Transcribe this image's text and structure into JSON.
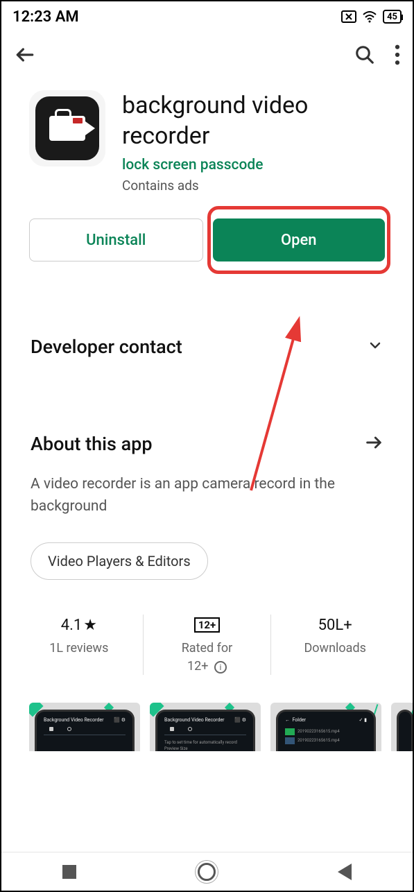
{
  "status": {
    "time": "12:23 AM",
    "battery": "45"
  },
  "app": {
    "title": "background video recorder",
    "developer": "lock screen passcode",
    "ads": "Contains ads"
  },
  "buttons": {
    "uninstall": "Uninstall",
    "open": "Open"
  },
  "sections": {
    "developer_contact": "Developer contact",
    "about_title": "About this app",
    "about_desc": "A video recorder is an app camera record in the background",
    "category_chip": "Video Players & Editors"
  },
  "stats": {
    "rating_value": "4.1",
    "rating_label": "1L reviews",
    "age_badge": "12+",
    "age_label_line1": "Rated for",
    "age_label_line2": "12+",
    "downloads_value": "50L+",
    "downloads_label": "Downloads"
  }
}
